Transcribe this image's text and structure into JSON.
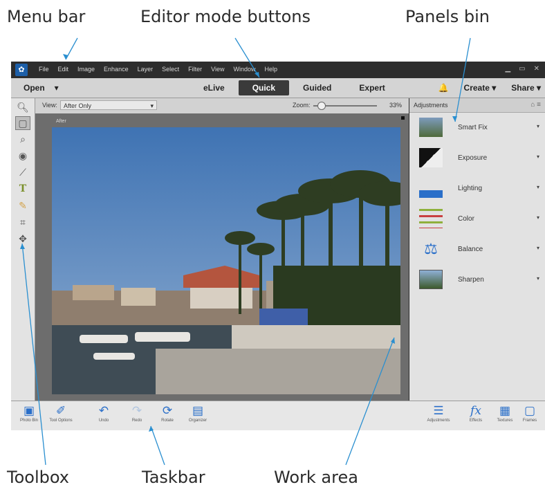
{
  "callouts": {
    "menu_bar": "Menu bar",
    "editor_mode_buttons": "Editor mode buttons",
    "panels_bin": "Panels bin",
    "toolbox": "Toolbox",
    "taskbar": "Taskbar",
    "work_area": "Work area"
  },
  "menubar": {
    "logo_icon": "photoshop-elements-logo-icon",
    "items": [
      "File",
      "Edit",
      "Image",
      "Enhance",
      "Layer",
      "Select",
      "Filter",
      "View",
      "Window",
      "Help"
    ],
    "window_controls": [
      "minimize-icon",
      "maximize-icon",
      "close-icon"
    ]
  },
  "modebar": {
    "open": "Open",
    "modes": [
      "eLive",
      "Quick",
      "Guided",
      "Expert"
    ],
    "active_mode": "Quick",
    "create": "Create",
    "share": "Share"
  },
  "toolbox": {
    "tools": [
      "zoom-icon",
      "hand-icon",
      "quick-selection-icon",
      "red-eye-icon",
      "whiten-teeth-icon",
      "type-icon",
      "spot-healing-icon",
      "crop-icon",
      "move-icon"
    ],
    "selected": "hand-icon"
  },
  "workarea": {
    "view_label": "View:",
    "view_value": "After Only",
    "zoom_label": "Zoom:",
    "zoom_value": "33%",
    "zoom_level": 0.12,
    "after_label": "After"
  },
  "panels": {
    "header": "Adjustments",
    "items": [
      {
        "label": "Smart Fix",
        "icon": "smart-fix-icon"
      },
      {
        "label": "Exposure",
        "icon": "exposure-icon"
      },
      {
        "label": "Lighting",
        "icon": "lighting-icon"
      },
      {
        "label": "Color",
        "icon": "color-icon"
      },
      {
        "label": "Balance",
        "icon": "balance-icon"
      },
      {
        "label": "Sharpen",
        "icon": "sharpen-icon"
      }
    ]
  },
  "taskbar": {
    "left": [
      {
        "label": "Photo Bin",
        "icon": "photo-bin-icon"
      },
      {
        "label": "Tool Options",
        "icon": "tool-options-icon"
      },
      {
        "label": "Undo",
        "icon": "undo-icon"
      },
      {
        "label": "Redo",
        "icon": "redo-icon"
      },
      {
        "label": "Rotate",
        "icon": "rotate-icon"
      },
      {
        "label": "Organizer",
        "icon": "organizer-icon"
      }
    ],
    "right": [
      {
        "label": "Adjustments",
        "icon": "adjustments-icon"
      },
      {
        "label": "Effects",
        "icon": "effects-icon"
      },
      {
        "label": "Textures",
        "icon": "textures-icon"
      },
      {
        "label": "Frames",
        "icon": "frames-icon"
      }
    ]
  },
  "colors": {
    "accent": "#2a6fc9",
    "menubar_bg": "#2d2d2d",
    "modebar_bg": "#d4d4d4",
    "active_mode_bg": "#3a3a3a",
    "callout_line": "#2a8fd0"
  }
}
